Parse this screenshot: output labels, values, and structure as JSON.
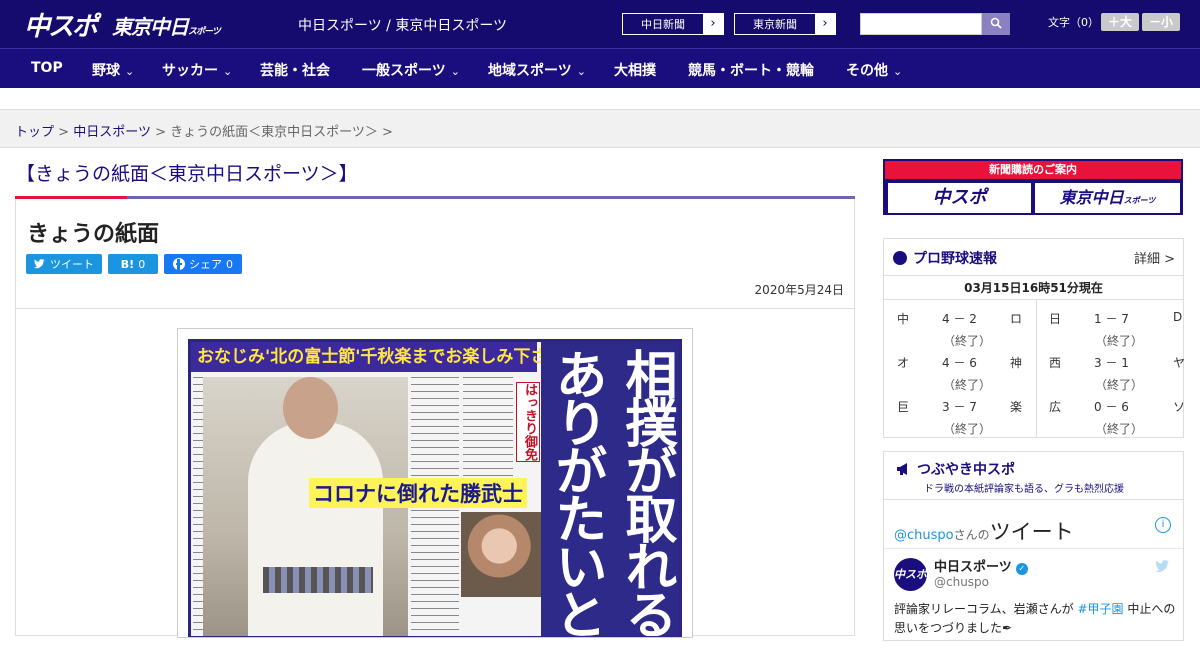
{
  "header": {
    "logo_main": "中スポ",
    "logo_sub": "東京中日",
    "logo_sub_small": "スポーツ",
    "site_title": "中日スポーツ / 東京中日スポーツ",
    "paper_buttons": [
      {
        "label": "中日新聞",
        "arrow": "›"
      },
      {
        "label": "東京新聞",
        "arrow": "›"
      }
    ],
    "search": {
      "value": "",
      "icon": "search-icon"
    },
    "font_size": {
      "label": "文字（0）",
      "bigger": "＋大",
      "smaller": "－小"
    }
  },
  "nav": {
    "items": [
      {
        "label": "TOP",
        "has_menu": false
      },
      {
        "label": "野球",
        "has_menu": true
      },
      {
        "label": "サッカー",
        "has_menu": true
      },
      {
        "label": "芸能・社会",
        "has_menu": false
      },
      {
        "label": "一般スポーツ",
        "has_menu": true
      },
      {
        "label": "地域スポーツ",
        "has_menu": true
      },
      {
        "label": "大相撲",
        "has_menu": false
      },
      {
        "label": "競馬・ボート・競輪",
        "has_menu": false
      },
      {
        "label": "その他",
        "has_menu": true
      }
    ],
    "chevron": "⌄"
  },
  "breadcrumb": {
    "items": [
      "トップ",
      "中日スポーツ",
      "きょうの紙面＜東京中日スポーツ＞"
    ],
    "sep": ">"
  },
  "page": {
    "title": "【きょうの紙面＜東京中日スポーツ＞】"
  },
  "article": {
    "title": "きょうの紙面",
    "share": {
      "tweet": "ツイート",
      "hatena": "B!",
      "hatena_count": "0",
      "facebook": "シェア",
      "facebook_count": "0"
    },
    "date": "2020年5月24日"
  },
  "newspaper": {
    "top_headline": "おなじみ'北の富士節'千秋楽までお楽しみ下さい",
    "covid_headline": "コロナに倒れた勝武士",
    "badge": "はっきり御免",
    "big_headline_1": "相撲が取れる",
    "big_headline_2": "ありがたいと"
  },
  "sidebar": {
    "promo": {
      "header": "新聞購読のご案内",
      "logo1": "中スポ",
      "logo2": "東京中日",
      "logo2_small": "スポーツ"
    },
    "scores": {
      "title": "プロ野球速報",
      "detail": "詳細 >",
      "as_of": "03月15日16時51分現在",
      "games": [
        {
          "home": "中",
          "score": "4 － 2",
          "away": "ロ",
          "status": "（終了）"
        },
        {
          "home": "日",
          "score": "1 － 7",
          "away": "D",
          "status": "（終了）"
        },
        {
          "home": "オ",
          "score": "4 － 6",
          "away": "神",
          "status": "（終了）"
        },
        {
          "home": "西",
          "score": "3 － 1",
          "away": "ヤ",
          "status": "（終了）"
        },
        {
          "home": "巨",
          "score": "3 － 7",
          "away": "楽",
          "status": "（終了）"
        },
        {
          "home": "広",
          "score": "0 － 6",
          "away": "ソ",
          "status": "（終了）"
        }
      ]
    },
    "tweets": {
      "title": "つぶやき中スポ",
      "subtitle": "ドラ戦の本紙評論家も語る、グラも熱烈応援",
      "account": "@chuspo",
      "account_suffix": "さんの",
      "tweet_word": "ツイート",
      "info": "i",
      "user_name": "中日スポーツ",
      "user_handle": "@chuspo",
      "avatar": "中スポ",
      "verified": "✓",
      "bird": "🐦",
      "text_1": "評論家リレーコラム、岩瀬さんが",
      "hashtag": "#甲子園",
      "text_2": "中止への思いをつづりました",
      "pen": "✒"
    }
  }
}
